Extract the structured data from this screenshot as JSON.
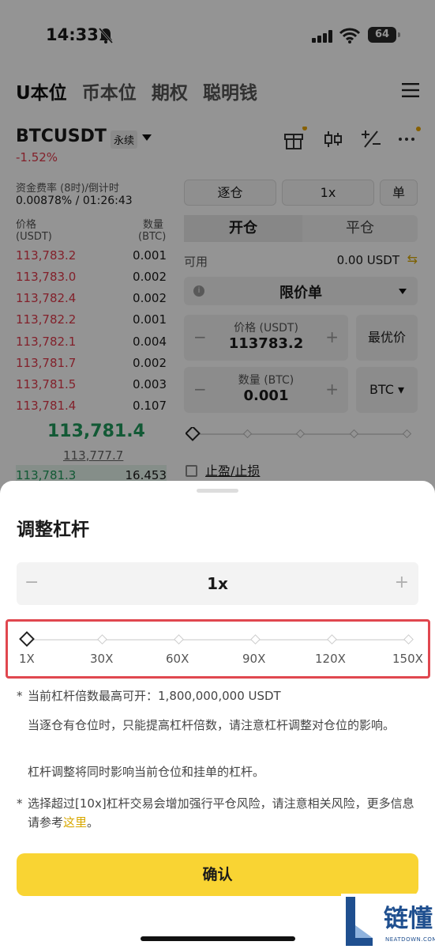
{
  "status_bar": {
    "time": "14:33",
    "battery": "64"
  },
  "nav": {
    "tabs": [
      "U本位",
      "币本位",
      "期权",
      "聪明钱"
    ],
    "active": 0
  },
  "symbol": {
    "pair": "BTCUSDT",
    "type": "永续",
    "change": "-1.52%"
  },
  "funding": {
    "label": "资金费率 (8时)/倒计时",
    "value": "0.00878% / 01:26:43"
  },
  "orderbook": {
    "price_header": "价格",
    "price_unit": "(USDT)",
    "qty_header": "数量",
    "qty_unit": "(BTC)",
    "asks": [
      {
        "price": "113,783.2",
        "qty": "0.001"
      },
      {
        "price": "113,783.0",
        "qty": "0.002"
      },
      {
        "price": "113,782.4",
        "qty": "0.002"
      },
      {
        "price": "113,782.2",
        "qty": "0.001"
      },
      {
        "price": "113,782.1",
        "qty": "0.004"
      },
      {
        "price": "113,781.7",
        "qty": "0.002"
      },
      {
        "price": "113,781.5",
        "qty": "0.003"
      },
      {
        "price": "113,781.4",
        "qty": "0.107"
      }
    ],
    "last_price": "113,781.4",
    "mark_price": "113,777.7",
    "bid": {
      "price": "113,781.3",
      "qty": "16.453"
    }
  },
  "order_form": {
    "margin_mode": "逐仓",
    "leverage": "1x",
    "position_mode": "单",
    "tab_open": "开仓",
    "tab_close": "平仓",
    "available_label": "可用",
    "available_value": "0.00 USDT",
    "order_type": "限价单",
    "price_label": "价格 (USDT)",
    "price_value": "113783.2",
    "best_price": "最优价",
    "qty_label": "数量 (BTC)",
    "qty_value": "0.001",
    "qty_unit": "BTC",
    "tpsl": "止盈/止损"
  },
  "sheet": {
    "title": "调整杠杆",
    "leverage_value": "1x",
    "slider_ticks": [
      "1X",
      "30X",
      "60X",
      "90X",
      "120X",
      "150X"
    ],
    "slider_fraction": 0,
    "note_max": "当前杠杆倍数最高可开：1,800,000,000 USDT",
    "note_isolated": "当逐仓有仓位时，只能提高杠杆倍数，请注意杠杆调整对仓位的影响。",
    "note_affects": "杠杆调整将同时影响当前仓位和挂单的杠杆。",
    "warning_text": "选择超过[10x]杠杆交易会增加强行平仓风险，请注意相关风险，更多信息请参考",
    "warning_link": "这里",
    "warning_end": "。",
    "confirm": "确认"
  },
  "watermark": {
    "text": "链懂",
    "sub": "NEATDOWN.COM"
  },
  "colors": {
    "red": "#e03a4b",
    "green": "#1f9a5c",
    "accent": "#f9d433",
    "highlight": "#e0474f"
  }
}
